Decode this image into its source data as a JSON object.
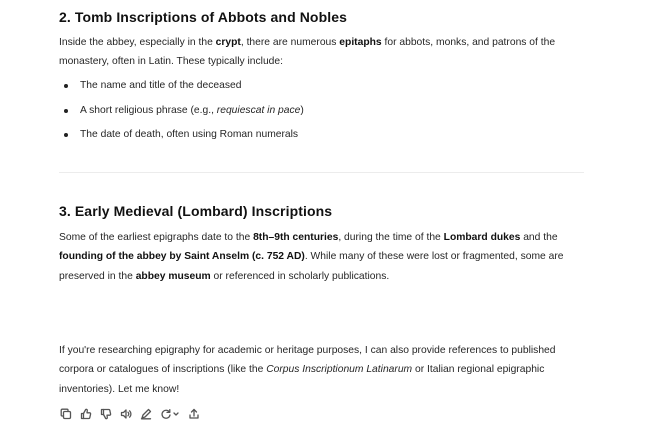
{
  "section2": {
    "heading": "2. Tomb Inscriptions of Abbots and Nobles",
    "intro": [
      {
        "t": "Inside the abbey, especially in the "
      },
      {
        "t": "crypt",
        "b": true
      },
      {
        "t": ", there are numerous "
      },
      {
        "t": "epitaphs",
        "b": true
      },
      {
        "t": " for abbots, monks, and patrons of the monastery, often in Latin. These typically include:"
      }
    ],
    "bullets": [
      [
        {
          "t": "The name and title of the deceased"
        }
      ],
      [
        {
          "t": "A short religious phrase (e.g., "
        },
        {
          "t": "requiescat in pace",
          "i": true
        },
        {
          "t": ")"
        }
      ],
      [
        {
          "t": "The date of death, often using Roman numerals"
        }
      ]
    ]
  },
  "section3": {
    "heading": "3. Early Medieval (Lombard) Inscriptions",
    "body": [
      {
        "t": "Some of the earliest epigraphs date to the "
      },
      {
        "t": "8th–9th centuries",
        "b": true
      },
      {
        "t": ", during the time of the "
      },
      {
        "t": "Lombard dukes",
        "b": true
      },
      {
        "t": " and the "
      },
      {
        "t": "founding of the abbey by Saint Anselm (c. 752 AD)",
        "b": true
      },
      {
        "t": ". While many of these were lost or fragmented, some are preserved in the "
      },
      {
        "t": "abbey museum",
        "b": true
      },
      {
        "t": " or referenced in scholarly publications."
      }
    ]
  },
  "closing": [
    {
      "t": "If you're researching epigraphy for academic or heritage purposes, I can also provide references to published corpora or catalogues of inscriptions (like the "
    },
    {
      "t": "Corpus Inscriptionum Latinarum",
      "i": true
    },
    {
      "t": " or Italian regional epigraphic inventories). Let me know!"
    }
  ],
  "actions": [
    "copy-icon",
    "thumbs-up-icon",
    "thumbs-down-icon",
    "read-aloud-icon",
    "edit-icon",
    "regenerate-icon",
    "share-icon"
  ]
}
